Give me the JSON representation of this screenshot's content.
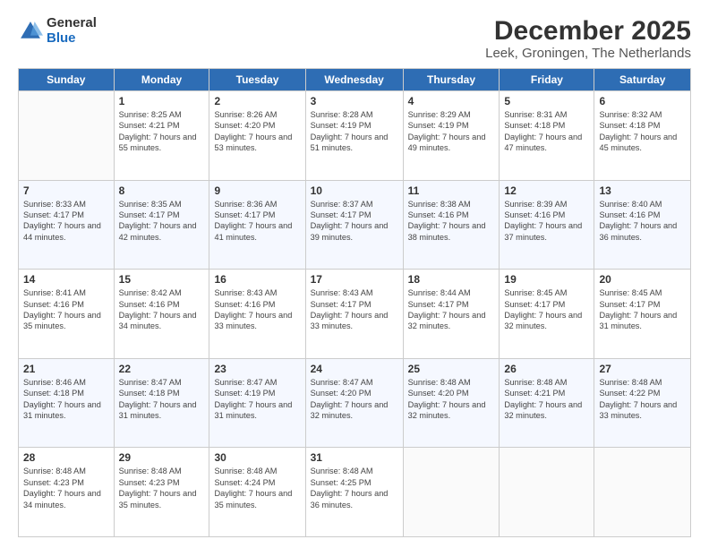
{
  "header": {
    "logo_general": "General",
    "logo_blue": "Blue",
    "title": "December 2025",
    "subtitle": "Leek, Groningen, The Netherlands"
  },
  "days_of_week": [
    "Sunday",
    "Monday",
    "Tuesday",
    "Wednesday",
    "Thursday",
    "Friday",
    "Saturday"
  ],
  "weeks": [
    [
      {
        "num": "",
        "sunrise": "",
        "sunset": "",
        "daylight": ""
      },
      {
        "num": "1",
        "sunrise": "Sunrise: 8:25 AM",
        "sunset": "Sunset: 4:21 PM",
        "daylight": "Daylight: 7 hours and 55 minutes."
      },
      {
        "num": "2",
        "sunrise": "Sunrise: 8:26 AM",
        "sunset": "Sunset: 4:20 PM",
        "daylight": "Daylight: 7 hours and 53 minutes."
      },
      {
        "num": "3",
        "sunrise": "Sunrise: 8:28 AM",
        "sunset": "Sunset: 4:19 PM",
        "daylight": "Daylight: 7 hours and 51 minutes."
      },
      {
        "num": "4",
        "sunrise": "Sunrise: 8:29 AM",
        "sunset": "Sunset: 4:19 PM",
        "daylight": "Daylight: 7 hours and 49 minutes."
      },
      {
        "num": "5",
        "sunrise": "Sunrise: 8:31 AM",
        "sunset": "Sunset: 4:18 PM",
        "daylight": "Daylight: 7 hours and 47 minutes."
      },
      {
        "num": "6",
        "sunrise": "Sunrise: 8:32 AM",
        "sunset": "Sunset: 4:18 PM",
        "daylight": "Daylight: 7 hours and 45 minutes."
      }
    ],
    [
      {
        "num": "7",
        "sunrise": "Sunrise: 8:33 AM",
        "sunset": "Sunset: 4:17 PM",
        "daylight": "Daylight: 7 hours and 44 minutes."
      },
      {
        "num": "8",
        "sunrise": "Sunrise: 8:35 AM",
        "sunset": "Sunset: 4:17 PM",
        "daylight": "Daylight: 7 hours and 42 minutes."
      },
      {
        "num": "9",
        "sunrise": "Sunrise: 8:36 AM",
        "sunset": "Sunset: 4:17 PM",
        "daylight": "Daylight: 7 hours and 41 minutes."
      },
      {
        "num": "10",
        "sunrise": "Sunrise: 8:37 AM",
        "sunset": "Sunset: 4:17 PM",
        "daylight": "Daylight: 7 hours and 39 minutes."
      },
      {
        "num": "11",
        "sunrise": "Sunrise: 8:38 AM",
        "sunset": "Sunset: 4:16 PM",
        "daylight": "Daylight: 7 hours and 38 minutes."
      },
      {
        "num": "12",
        "sunrise": "Sunrise: 8:39 AM",
        "sunset": "Sunset: 4:16 PM",
        "daylight": "Daylight: 7 hours and 37 minutes."
      },
      {
        "num": "13",
        "sunrise": "Sunrise: 8:40 AM",
        "sunset": "Sunset: 4:16 PM",
        "daylight": "Daylight: 7 hours and 36 minutes."
      }
    ],
    [
      {
        "num": "14",
        "sunrise": "Sunrise: 8:41 AM",
        "sunset": "Sunset: 4:16 PM",
        "daylight": "Daylight: 7 hours and 35 minutes."
      },
      {
        "num": "15",
        "sunrise": "Sunrise: 8:42 AM",
        "sunset": "Sunset: 4:16 PM",
        "daylight": "Daylight: 7 hours and 34 minutes."
      },
      {
        "num": "16",
        "sunrise": "Sunrise: 8:43 AM",
        "sunset": "Sunset: 4:16 PM",
        "daylight": "Daylight: 7 hours and 33 minutes."
      },
      {
        "num": "17",
        "sunrise": "Sunrise: 8:43 AM",
        "sunset": "Sunset: 4:17 PM",
        "daylight": "Daylight: 7 hours and 33 minutes."
      },
      {
        "num": "18",
        "sunrise": "Sunrise: 8:44 AM",
        "sunset": "Sunset: 4:17 PM",
        "daylight": "Daylight: 7 hours and 32 minutes."
      },
      {
        "num": "19",
        "sunrise": "Sunrise: 8:45 AM",
        "sunset": "Sunset: 4:17 PM",
        "daylight": "Daylight: 7 hours and 32 minutes."
      },
      {
        "num": "20",
        "sunrise": "Sunrise: 8:45 AM",
        "sunset": "Sunset: 4:17 PM",
        "daylight": "Daylight: 7 hours and 31 minutes."
      }
    ],
    [
      {
        "num": "21",
        "sunrise": "Sunrise: 8:46 AM",
        "sunset": "Sunset: 4:18 PM",
        "daylight": "Daylight: 7 hours and 31 minutes."
      },
      {
        "num": "22",
        "sunrise": "Sunrise: 8:47 AM",
        "sunset": "Sunset: 4:18 PM",
        "daylight": "Daylight: 7 hours and 31 minutes."
      },
      {
        "num": "23",
        "sunrise": "Sunrise: 8:47 AM",
        "sunset": "Sunset: 4:19 PM",
        "daylight": "Daylight: 7 hours and 31 minutes."
      },
      {
        "num": "24",
        "sunrise": "Sunrise: 8:47 AM",
        "sunset": "Sunset: 4:20 PM",
        "daylight": "Daylight: 7 hours and 32 minutes."
      },
      {
        "num": "25",
        "sunrise": "Sunrise: 8:48 AM",
        "sunset": "Sunset: 4:20 PM",
        "daylight": "Daylight: 7 hours and 32 minutes."
      },
      {
        "num": "26",
        "sunrise": "Sunrise: 8:48 AM",
        "sunset": "Sunset: 4:21 PM",
        "daylight": "Daylight: 7 hours and 32 minutes."
      },
      {
        "num": "27",
        "sunrise": "Sunrise: 8:48 AM",
        "sunset": "Sunset: 4:22 PM",
        "daylight": "Daylight: 7 hours and 33 minutes."
      }
    ],
    [
      {
        "num": "28",
        "sunrise": "Sunrise: 8:48 AM",
        "sunset": "Sunset: 4:23 PM",
        "daylight": "Daylight: 7 hours and 34 minutes."
      },
      {
        "num": "29",
        "sunrise": "Sunrise: 8:48 AM",
        "sunset": "Sunset: 4:23 PM",
        "daylight": "Daylight: 7 hours and 35 minutes."
      },
      {
        "num": "30",
        "sunrise": "Sunrise: 8:48 AM",
        "sunset": "Sunset: 4:24 PM",
        "daylight": "Daylight: 7 hours and 35 minutes."
      },
      {
        "num": "31",
        "sunrise": "Sunrise: 8:48 AM",
        "sunset": "Sunset: 4:25 PM",
        "daylight": "Daylight: 7 hours and 36 minutes."
      },
      {
        "num": "",
        "sunrise": "",
        "sunset": "",
        "daylight": ""
      },
      {
        "num": "",
        "sunrise": "",
        "sunset": "",
        "daylight": ""
      },
      {
        "num": "",
        "sunrise": "",
        "sunset": "",
        "daylight": ""
      }
    ]
  ]
}
